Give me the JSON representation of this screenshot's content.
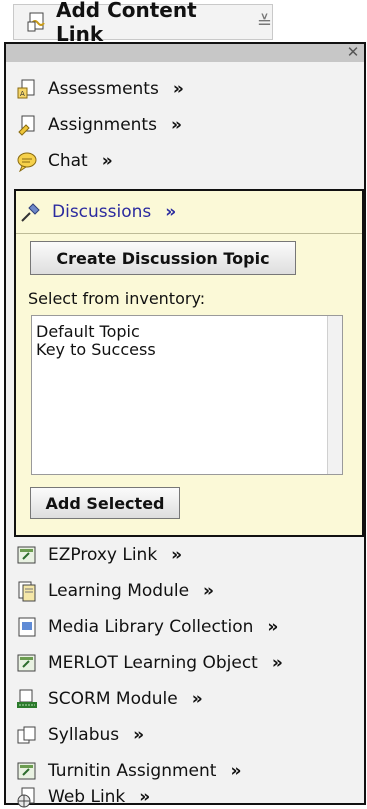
{
  "header": {
    "title": "Add Content Link",
    "sort_symbol": "≚"
  },
  "panel": {
    "close_symbol": "✕"
  },
  "items_top": [
    {
      "label": "Assessments",
      "chevron": "»",
      "icon": "assessments-icon"
    },
    {
      "label": "Assignments",
      "chevron": "»",
      "icon": "assignments-icon"
    },
    {
      "label": "Chat",
      "chevron": "»",
      "icon": "chat-icon"
    }
  ],
  "discussions": {
    "label": "Discussions",
    "chevron": "»",
    "icon": "pushpin-icon",
    "create_button": "Create Discussion Topic",
    "inventory_label": "Select from inventory:",
    "options": [
      "Default Topic",
      "Key to Success"
    ],
    "add_button": "Add Selected"
  },
  "items_bottom": [
    {
      "label": "EZProxy Link",
      "chevron": "»",
      "icon": "ezproxy-icon"
    },
    {
      "label": "Learning Module",
      "chevron": "»",
      "icon": "learning-module-icon"
    },
    {
      "label": "Media Library Collection",
      "chevron": "»",
      "icon": "media-library-icon"
    },
    {
      "label": "MERLOT Learning Object",
      "chevron": "»",
      "icon": "merlot-icon"
    },
    {
      "label": "SCORM Module",
      "chevron": "»",
      "icon": "scorm-icon"
    },
    {
      "label": "Syllabus",
      "chevron": "»",
      "icon": "syllabus-icon"
    },
    {
      "label": "Turnitin Assignment",
      "chevron": "»",
      "icon": "turnitin-icon"
    },
    {
      "label": "Web Link",
      "chevron": "»",
      "icon": "web-link-icon"
    }
  ]
}
